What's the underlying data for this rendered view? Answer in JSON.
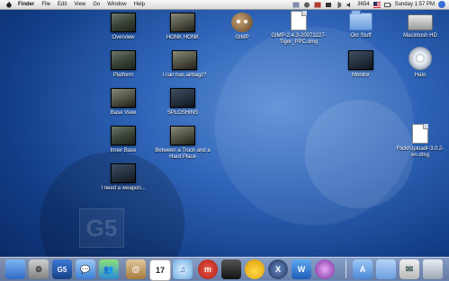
{
  "menubar": {
    "app": "Finder",
    "items": [
      "File",
      "Edit",
      "View",
      "Go",
      "Window",
      "Help"
    ],
    "status_number": "3654",
    "clock": "Sunday 1:57 PM"
  },
  "desktop": {
    "icons": [
      {
        "label": "Overview"
      },
      {
        "label": "HONK HONK"
      },
      {
        "label": "GIMP"
      },
      {
        "label": "GIMP-2.4.3-20071227-Tiger_PPC.dmg"
      },
      {
        "label": "Old Stuff"
      },
      {
        "label": "Macintosh HD"
      },
      {
        "label": "Platform"
      },
      {
        "label": "I can has airbagz?"
      },
      {
        "label": "Monitor"
      },
      {
        "label": "Halo"
      },
      {
        "label": "Base View"
      },
      {
        "label": "SPLOSHINS"
      },
      {
        "label": "Inner Base"
      },
      {
        "label": "Between a Truck and a Hard Place"
      },
      {
        "label": "FlickrUploadr-3.0.2-en.dmg"
      },
      {
        "label": "I need a weapon..."
      }
    ]
  },
  "wallpaper": {
    "mark": "G5"
  },
  "dock": {
    "items": [
      {
        "name": "finder",
        "glyph": ""
      },
      {
        "name": "system-preferences",
        "glyph": "⚙"
      },
      {
        "name": "g5",
        "glyph": "G5"
      },
      {
        "name": "ichat",
        "glyph": "💬"
      },
      {
        "name": "msn-messenger",
        "glyph": "👥"
      },
      {
        "name": "address-book",
        "glyph": "@"
      },
      {
        "name": "ical",
        "glyph": "17"
      },
      {
        "name": "itunes",
        "glyph": "♫"
      },
      {
        "name": "miro",
        "glyph": "m"
      },
      {
        "name": "photo-booth",
        "glyph": ""
      },
      {
        "name": "cyberduck",
        "glyph": ""
      },
      {
        "name": "xcode",
        "glyph": "X"
      },
      {
        "name": "word",
        "glyph": "W"
      },
      {
        "name": "itunes-2",
        "glyph": ""
      },
      {
        "name": "applications",
        "glyph": "A"
      },
      {
        "name": "documents",
        "glyph": ""
      },
      {
        "name": "mail",
        "glyph": "✉"
      },
      {
        "name": "trash",
        "glyph": ""
      }
    ]
  }
}
